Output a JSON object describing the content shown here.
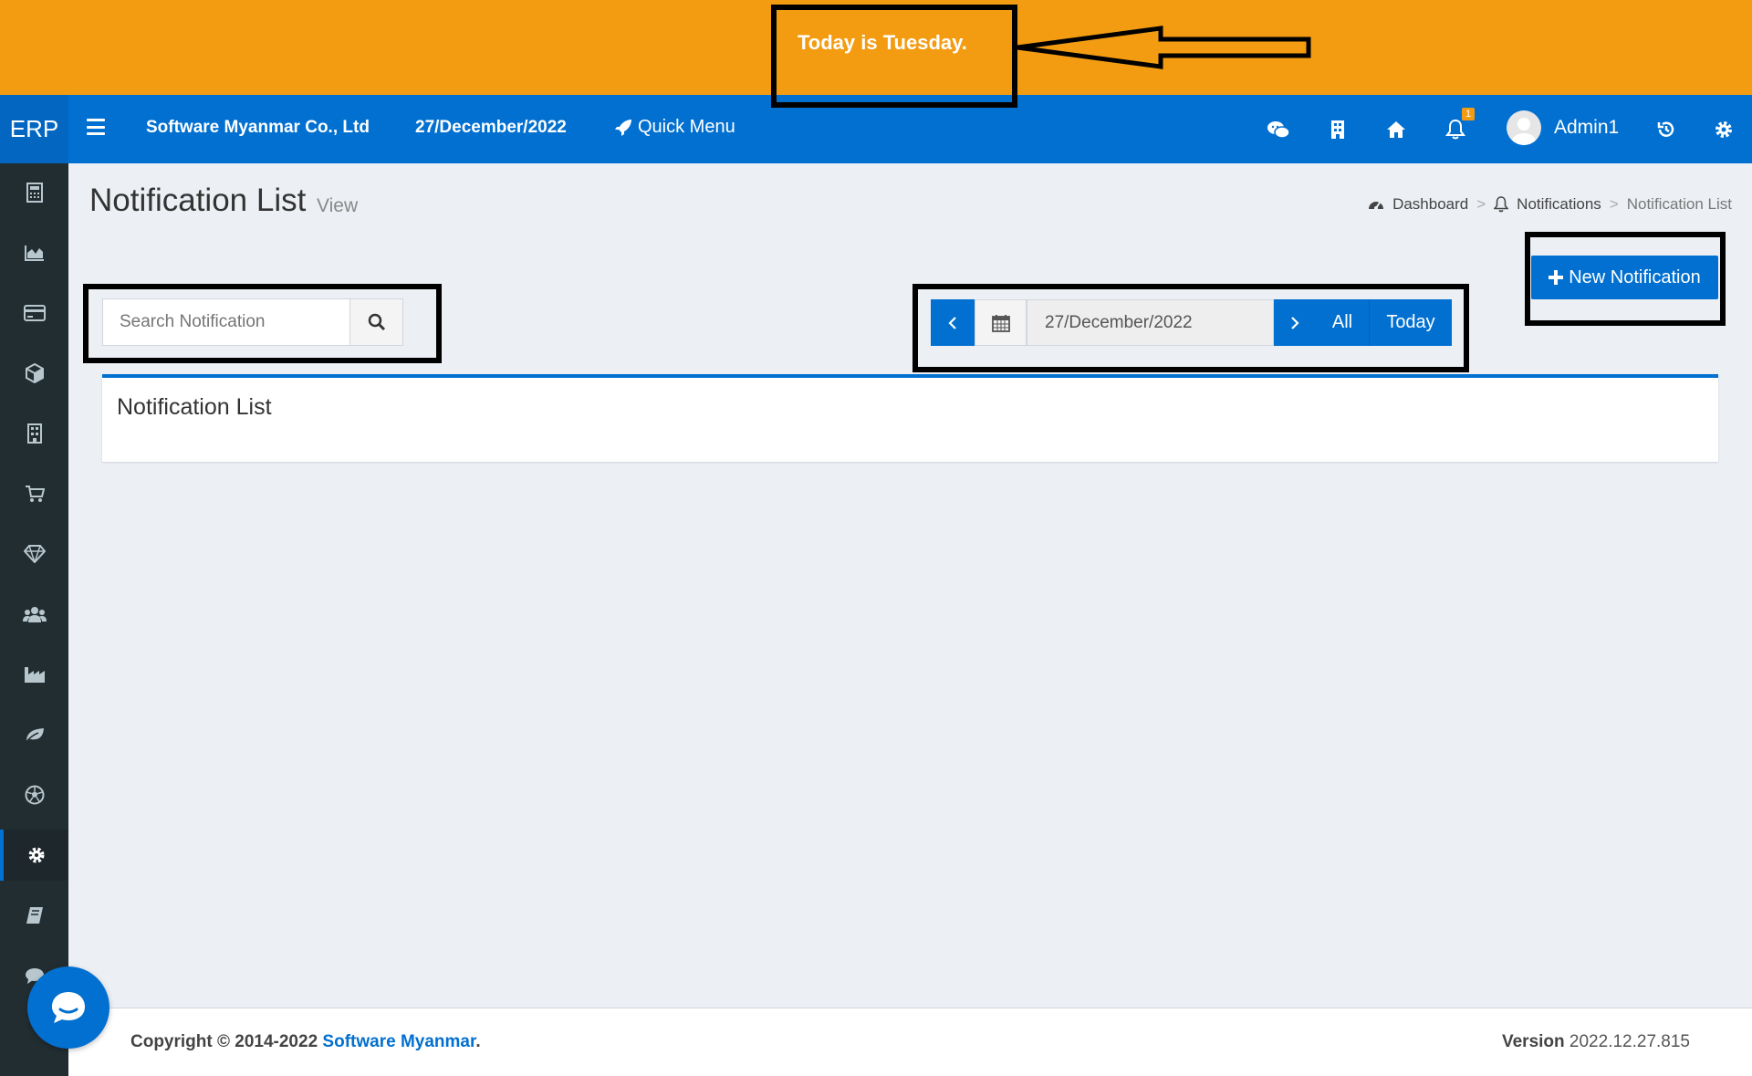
{
  "banner": {
    "text": "Today is Tuesday.",
    "color": "#f39c12"
  },
  "header": {
    "logo": "ERP",
    "company": "Software Myanmar Co., Ltd",
    "date": "27/December/2022",
    "quick_menu": "Quick Menu",
    "notification_count": "1",
    "user_name": "Admin1",
    "icons": [
      "menu-icon",
      "rocket-icon",
      "wechat-icon",
      "building-icon",
      "home-icon",
      "bell-icon",
      "avatar",
      "history-icon",
      "gear-icon"
    ],
    "accent": "#0270d0"
  },
  "sidebar": {
    "items": [
      {
        "icon": "calculator-icon"
      },
      {
        "icon": "area-chart-icon"
      },
      {
        "icon": "credit-card-icon"
      },
      {
        "icon": "cube-icon"
      },
      {
        "icon": "building-icon"
      },
      {
        "icon": "cart-icon"
      },
      {
        "icon": "diamond-icon"
      },
      {
        "icon": "users-icon"
      },
      {
        "icon": "industry-icon"
      },
      {
        "icon": "leaf-icon"
      },
      {
        "icon": "soccer-ball-icon"
      },
      {
        "icon": "gear-icon",
        "active": true
      },
      {
        "icon": "book-icon"
      },
      {
        "icon": "comment-icon"
      }
    ]
  },
  "page": {
    "title": "Notification List",
    "subtitle": "View"
  },
  "breadcrumb": {
    "items": [
      "Dashboard",
      "Notifications",
      "Notification List"
    ],
    "separator": ">"
  },
  "toolbar": {
    "new_button": "New Notification",
    "search_placeholder": "Search Notification",
    "date_value": "27/December/2022",
    "all_label": "All",
    "today_label": "Today"
  },
  "panel": {
    "title": "Notification List"
  },
  "footer": {
    "copyright_prefix": "Copyright © 2014-2022",
    "copyright_link": "Software Myanmar",
    "copyright_suffix": ".",
    "version_label": "Version",
    "version_value": "2022.12.27.815"
  }
}
